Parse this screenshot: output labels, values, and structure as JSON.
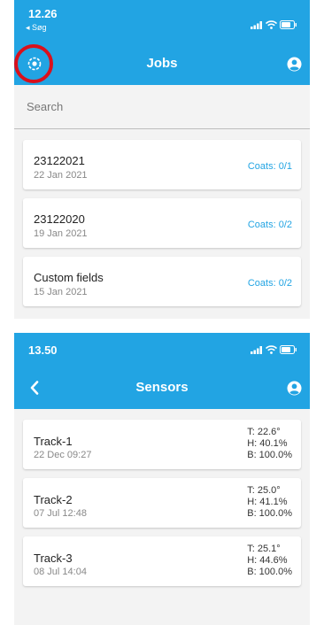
{
  "colors": {
    "accent": "#22a4e3",
    "highlight": "#d9101c",
    "background": "#f3f3f3"
  },
  "jobs_screen": {
    "status": {
      "time": "12.26",
      "back_label": "◂ Søg"
    },
    "header": {
      "title": "Jobs",
      "left_icon": "location-target-icon",
      "right_icon": "user-icon"
    },
    "search": {
      "placeholder": "Search"
    },
    "jobs": [
      {
        "name": "23122021",
        "date": "22 Jan 2021",
        "coats": "Coats: 0/1"
      },
      {
        "name": "23122020",
        "date": "19 Jan 2021",
        "coats": "Coats: 0/2"
      },
      {
        "name": "Custom fields",
        "date": "15 Jan 2021",
        "coats": "Coats: 0/2"
      }
    ]
  },
  "sensors_screen": {
    "status": {
      "time": "13.50"
    },
    "header": {
      "title": "Sensors",
      "left_icon": "chevron-left-icon",
      "right_icon": "user-icon"
    },
    "sensors": [
      {
        "name": "Track-1",
        "time": "22 Dec 09:27",
        "t": "T: 22.6°",
        "h": "H: 40.1%",
        "b": "B: 100.0%"
      },
      {
        "name": "Track-2",
        "time": "07 Jul 12:48",
        "t": "T: 25.0°",
        "h": "H: 41.1%",
        "b": "B: 100.0%"
      },
      {
        "name": "Track-3",
        "time": "08 Jul 14:04",
        "t": "T: 25.1°",
        "h": "H: 44.6%",
        "b": "B: 100.0%"
      }
    ]
  }
}
